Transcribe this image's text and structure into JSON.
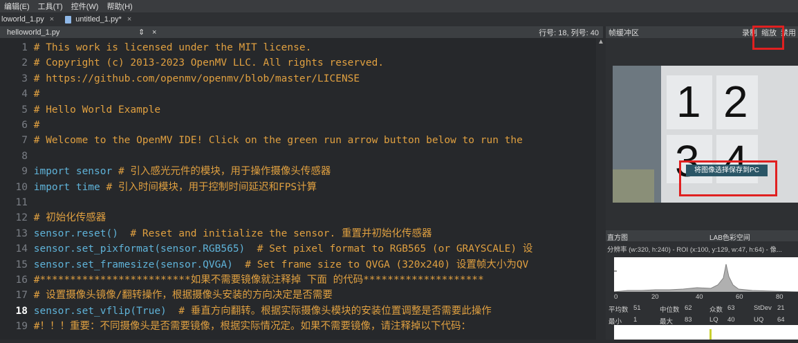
{
  "menu": [
    "编辑(E)",
    "工具(T)",
    "控件(W)",
    "帮助(H)"
  ],
  "tabs": [
    {
      "label": "loworld_1.py",
      "close": "×"
    },
    {
      "label": "untitled_1.py*",
      "close": "×"
    }
  ],
  "editor": {
    "filename": "helloworld_1.py",
    "selector": "⇕",
    "close": "×",
    "position": "行号: 18, 列号: 40",
    "current_line": 18,
    "lines": [
      {
        "n": "1",
        "t": "# This work is licensed under the MIT license.",
        "k": "cmt"
      },
      {
        "n": "2",
        "t": "# Copyright (c) 2013-2023 OpenMV LLC. All rights reserved.",
        "k": "cmt"
      },
      {
        "n": "3",
        "t": "# https://github.com/openmv/openmv/blob/master/LICENSE",
        "k": "cmt"
      },
      {
        "n": "4",
        "t": "#",
        "k": "cmt"
      },
      {
        "n": "5",
        "t": "# Hello World Example",
        "k": "cmt"
      },
      {
        "n": "6",
        "t": "#",
        "k": "cmt"
      },
      {
        "n": "7",
        "t": "# Welcome to the OpenMV IDE! Click on the green run arrow button below to run the",
        "k": "cmt"
      },
      {
        "n": "8",
        "t": "",
        "k": "code"
      },
      {
        "n": "9",
        "t": "import sensor # 引入感光元件的模块，用于操作摄像头传感器",
        "k": "imp"
      },
      {
        "n": "10",
        "t": "import time # 引入时间模块，用于控制时间延迟和FPS计算",
        "k": "imp"
      },
      {
        "n": "11",
        "t": "",
        "k": "code"
      },
      {
        "n": "12",
        "t": "# 初始化传感器",
        "k": "cmt"
      },
      {
        "n": "13",
        "t": "sensor.reset()  # Reset and initialize the sensor. 重置并初始化传感器",
        "k": "call"
      },
      {
        "n": "14",
        "t": "sensor.set_pixformat(sensor.RGB565)  # Set pixel format to RGB565 (or GRAYSCALE) 设",
        "k": "call"
      },
      {
        "n": "15",
        "t": "sensor.set_framesize(sensor.QVGA)  # Set frame size to QVGA (320x240) 设置帧大小为QV",
        "k": "call"
      },
      {
        "n": "16",
        "t": "#*************************如果不需要镜像就注释掉 下面 的代码********************",
        "k": "cmt"
      },
      {
        "n": "17",
        "t": "# 设置摄像头镜像/翻转操作，根据摄像头安装的方向决定是否需要",
        "k": "cmt"
      },
      {
        "n": "18",
        "t": "sensor.set_vflip(True)  # 垂直方向翻转。根据实际摄像头模块的安装位置调整是否需要此操作",
        "k": "call"
      },
      {
        "n": "19",
        "t": "#！！！重要：不同摄像头是否需要镜像，根据实际情况定。如果不需要镜像，请注释掉以下代码：",
        "k": "cmt"
      }
    ]
  },
  "framebuffer": {
    "title": "帧缓冲区",
    "buttons": [
      "录制",
      "缩放",
      "禁用"
    ],
    "digits": [
      "1",
      "2",
      "3",
      "4"
    ],
    "context_menu_item": "将图像选择保存到PC"
  },
  "histogram": {
    "title": "直方图",
    "colorspace": "LAB色彩空间",
    "info": "分辨率 (w:320, h:240) - ROI (x:100, y:129, w:47, h:64) - 像...",
    "axis": [
      "0",
      "20",
      "40",
      "60",
      "80"
    ],
    "stats_row1": [
      [
        "平均数",
        "51"
      ],
      [
        "中位数",
        "62"
      ],
      [
        "众数",
        "63"
      ],
      [
        "StDev",
        "21"
      ]
    ],
    "stats_row2": [
      [
        "最小",
        "1"
      ],
      [
        "最大",
        "83"
      ],
      [
        "LQ",
        "40"
      ],
      [
        "UQ",
        "64"
      ]
    ]
  },
  "colors": {
    "highlight": "#e02020",
    "comment": "#e0a040",
    "keyword": "#5fb3d9"
  }
}
